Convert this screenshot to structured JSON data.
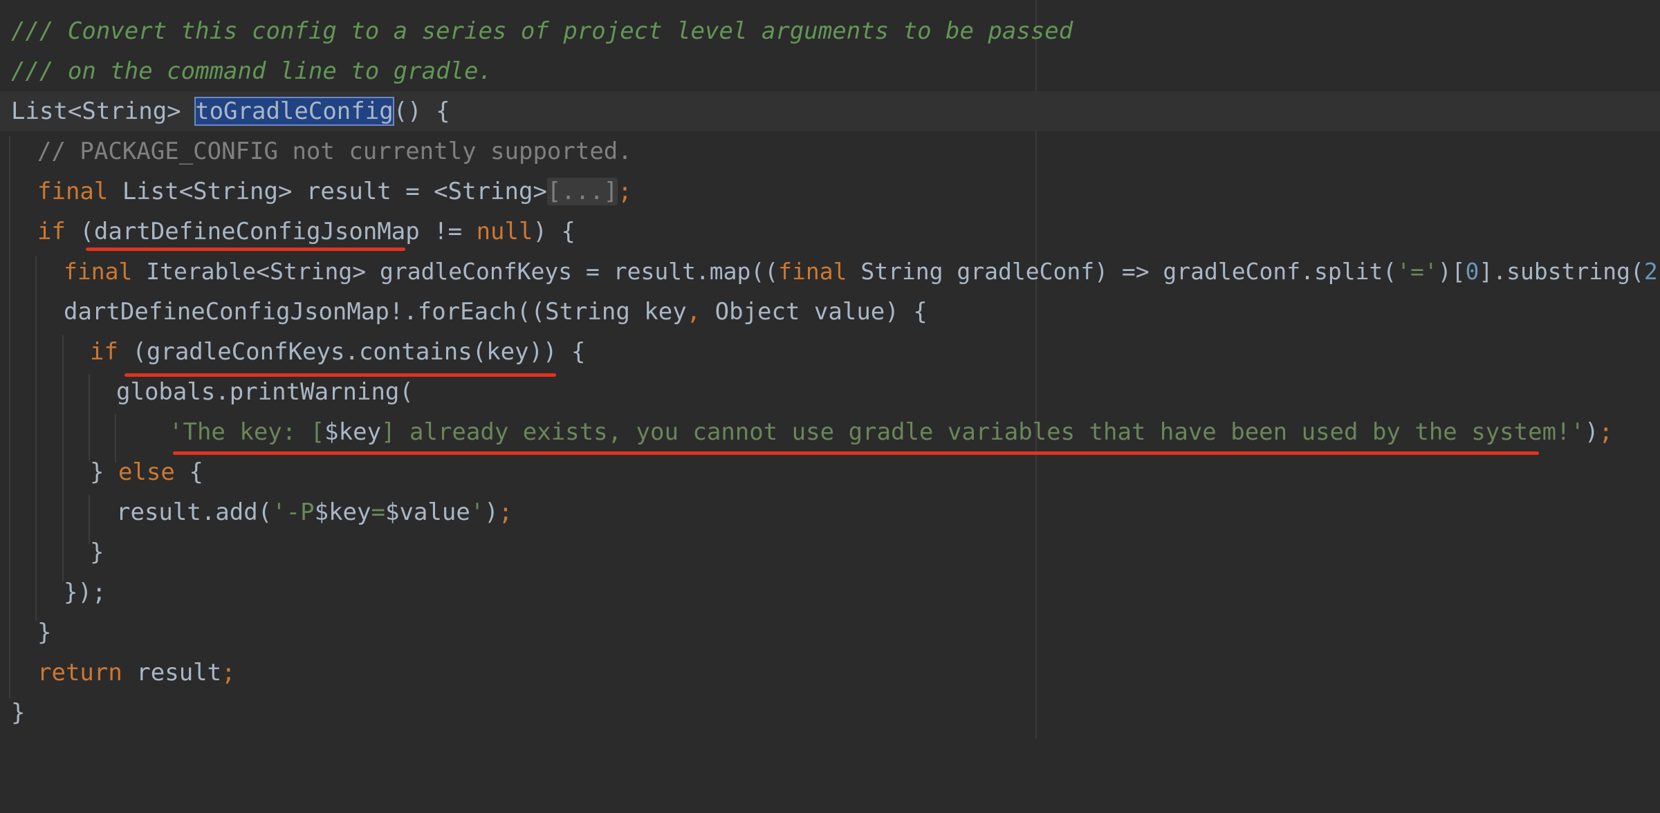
{
  "editor": {
    "lines": [
      [
        "/// Convert this config to a series of project level arguments to be passed"
      ],
      [
        "/// on the command line to gradle."
      ],
      [
        "List<String> ",
        "toGradleConfig",
        "() {"
      ],
      [
        "// PACKAGE_CONFIG not currently supported."
      ],
      [
        "final",
        " List<String> result = <String>",
        "[...]",
        ";"
      ],
      [
        "if",
        " (dartDefineConfigJsonMap != ",
        "null",
        ") {"
      ],
      [
        "final",
        " Iterable<String> gradleConfKeys = result.map((",
        "final",
        " String gradleConf) => gradleConf.split(",
        "'='",
        ")[",
        "0",
        "].substring(",
        "2",
        "));"
      ],
      [
        "dartDefineConfigJsonMap!.forEach((String key",
        ",",
        " Object value) {"
      ],
      [
        "if",
        " (gradleConfKeys.contains(key)) {"
      ],
      [
        "globals.printWarning("
      ],
      [
        "'The key: [",
        "$key",
        "] already exists, you cannot use gradle variables that have been used by the system!'",
        ")",
        ";"
      ],
      [
        "} ",
        "else",
        " {"
      ],
      [
        "result.add(",
        "'-P",
        "$key",
        "=",
        "$value",
        "'",
        ")",
        ";"
      ],
      [
        "}"
      ],
      [
        "});"
      ],
      [
        "}"
      ],
      [
        "return",
        " result",
        ";"
      ],
      [
        "}"
      ]
    ]
  },
  "colors": {
    "background": "#2b2b2b",
    "default_text": "#a9b7c6",
    "doc_comment": "#629755",
    "comment": "#808080",
    "keyword": "#cc7832",
    "string": "#6a8759",
    "number": "#6897bb",
    "selection": "#214283",
    "annotation_underline": "#e3331f"
  }
}
